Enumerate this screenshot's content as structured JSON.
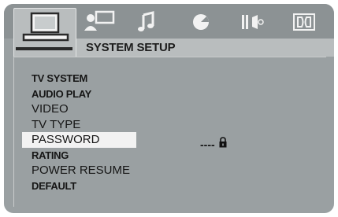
{
  "header": {
    "title": "SYSTEM SETUP",
    "tabs": [
      {
        "icon": "tv-monitor-icon",
        "active": true
      },
      {
        "icon": "user-screen-icon",
        "active": false
      },
      {
        "icon": "music-note-icon",
        "active": false
      },
      {
        "icon": "disc-icon",
        "active": false
      },
      {
        "icon": "speaker-icon",
        "active": false
      },
      {
        "icon": "dolby-icon",
        "active": false
      }
    ]
  },
  "menu": {
    "items": [
      {
        "label": "TV SYSTEM"
      },
      {
        "label": "AUDIO PLAY"
      },
      {
        "label": "VIDEO"
      },
      {
        "label": "TV TYPE"
      },
      {
        "label": "PASSWORD"
      },
      {
        "label": "RATING"
      },
      {
        "label": "POWER RESUME"
      },
      {
        "label": "DEFAULT"
      }
    ],
    "selected": "PASSWORD"
  },
  "password": {
    "value": "----",
    "icon": "lock-icon"
  },
  "colors": {
    "background": "#9aa0a2",
    "tab_active": "#b9bdbe",
    "selection": "#f2f2f2",
    "text": "#161616"
  }
}
